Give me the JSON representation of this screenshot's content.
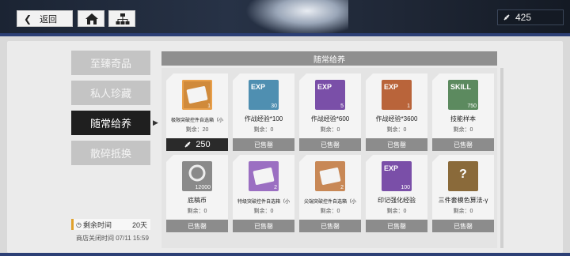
{
  "header": {
    "back_label": "返回",
    "currency_value": "425"
  },
  "sidebar": {
    "items": [
      {
        "label": "至臻奇品",
        "active": false
      },
      {
        "label": "私人珍藏",
        "active": false
      },
      {
        "label": "随常给养",
        "active": true
      },
      {
        "label": "散碎抵换",
        "active": false
      }
    ],
    "remaining_label": "剩余时间",
    "remaining_value": "20天",
    "close_time": "商店关闭时间 07/11 15:59"
  },
  "section_title": "随常给养",
  "stock_label": "剩余：",
  "items": [
    {
      "name": "极限突破控件自选箱（小",
      "stock": "20",
      "count": "1",
      "footer": "250",
      "sold": false,
      "color": "orange",
      "icon": "box-icon"
    },
    {
      "name": "作战经验*100",
      "stock": "0",
      "count": "30",
      "footer": "已售罄",
      "sold": true,
      "color": "blue",
      "icon": "exp-card-icon",
      "tag": "EXP"
    },
    {
      "name": "作战经验*600",
      "stock": "0",
      "count": "5",
      "footer": "已售罄",
      "sold": true,
      "color": "purple",
      "icon": "exp-card-icon",
      "tag": "EXP"
    },
    {
      "name": "作战经验*3600",
      "stock": "0",
      "count": "1",
      "footer": "已售罄",
      "sold": true,
      "color": "rust",
      "icon": "exp-card-icon",
      "tag": "EXP"
    },
    {
      "name": "技能样本",
      "stock": "0",
      "count": "750",
      "footer": "已售罄",
      "sold": true,
      "color": "green",
      "icon": "skill-card-icon",
      "tag": "SKILL"
    },
    {
      "name": "底稿币",
      "stock": "0",
      "count": "12000",
      "footer": "已售罄",
      "sold": true,
      "color": "grey",
      "icon": "coin-icon"
    },
    {
      "name": "特级突破控件自选箱（小",
      "stock": "0",
      "count": "2",
      "footer": "已售罄",
      "sold": true,
      "color": "lightpurple",
      "icon": "box-icon"
    },
    {
      "name": "尖端突破控件自选箱（小",
      "stock": "0",
      "count": "2",
      "footer": "已售罄",
      "sold": true,
      "color": "lightorange",
      "icon": "box-icon"
    },
    {
      "name": "印记强化经验",
      "stock": "0",
      "count": "100",
      "footer": "已售罄",
      "sold": true,
      "color": "purple",
      "icon": "exp-card-icon",
      "tag": "EXP"
    },
    {
      "name": "三件套模色算法-γ",
      "stock": "0",
      "count": "",
      "footer": "已售罄",
      "sold": true,
      "color": "gold",
      "icon": "question-icon",
      "tag": "?"
    }
  ],
  "colors": {
    "accent_orange": "#e9a04b",
    "active_tab": "#1f1f1f",
    "sold_footer": "#8c8c8c",
    "price_footer": "#2a2a2a",
    "header_bar": "#8f8f8f"
  }
}
